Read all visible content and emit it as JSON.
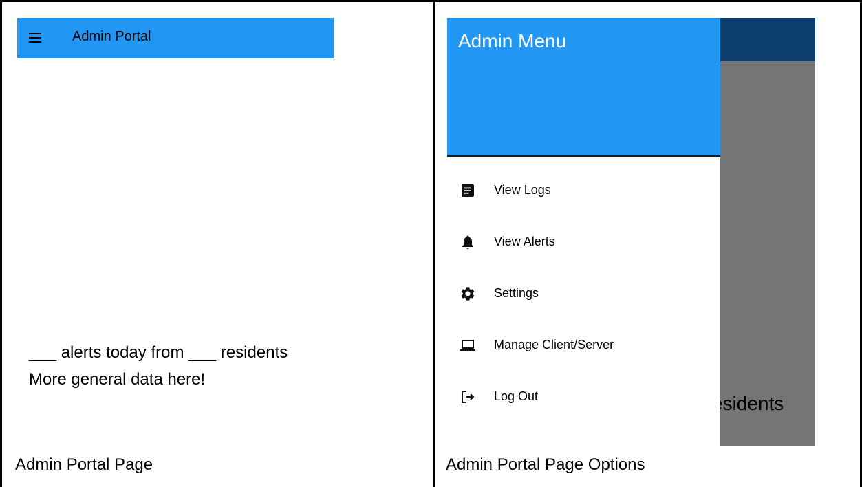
{
  "left_panel": {
    "app_bar": {
      "title": "Admin Portal",
      "menu_icon": "hamburger-menu-icon"
    },
    "stats_text": "___ alerts today from ___ residents",
    "info_text": "More general data here!",
    "caption": "Admin Portal Page"
  },
  "right_panel": {
    "drawer": {
      "title": "Admin Menu",
      "items": [
        {
          "label": "View Logs",
          "icon": "document-icon"
        },
        {
          "label": "View Alerts",
          "icon": "bell-icon"
        },
        {
          "label": "Settings",
          "icon": "gear-icon"
        },
        {
          "label": "Manage Client/Server",
          "icon": "laptop-icon"
        },
        {
          "label": "Log Out",
          "icon": "logout-icon"
        }
      ]
    },
    "background_partial_text": "esidents",
    "caption": "Admin Portal Page Options"
  },
  "colors": {
    "app_bar": "#2196f3",
    "drawer_header": "#2196f3",
    "dark_app_bar": "#0d3f6e",
    "scrim": "#757575"
  }
}
